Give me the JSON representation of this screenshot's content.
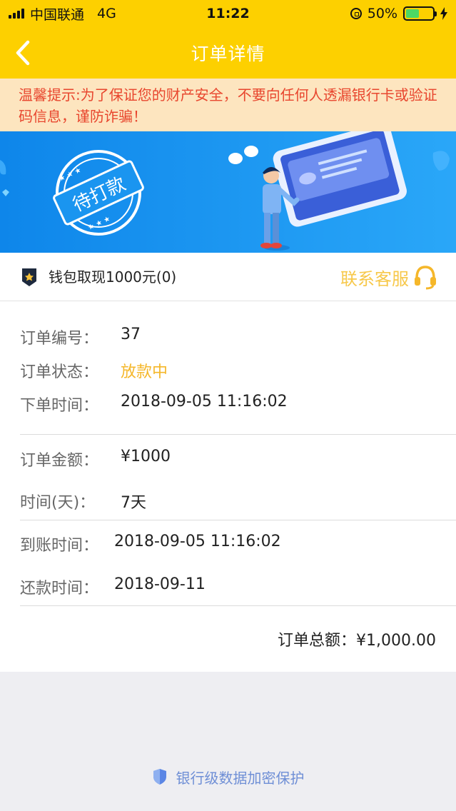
{
  "status_bar": {
    "carrier": "中国联通",
    "network": "4G",
    "time": "11:22",
    "battery": "50%",
    "battery_level": 0.5
  },
  "nav": {
    "title": "订单详情"
  },
  "warning": {
    "text": "温馨提示:为了保证您的财产安全，不要向任何人透漏银行卡或验证码信息，谨防诈骗！"
  },
  "banner": {
    "stamp": "待打款"
  },
  "wallet": {
    "text": "钱包取现1000元(0)",
    "contact": "联系客服"
  },
  "details": {
    "order_no_label": "订单编号：",
    "order_no": "37",
    "status_label": "订单状态：",
    "status": "放款中",
    "order_time_label": "下单时间：",
    "order_time": "2018-09-05 11:16:02",
    "amount_label": "订单金额：",
    "amount": "¥1000",
    "days_label": "时间(天)：",
    "days": "7天",
    "arrival_label": "到账时间：",
    "arrival": "2018-09-05 11:16:02",
    "repay_label": "还款时间：",
    "repay": "2018-09-11",
    "total_label": "订单总额：",
    "total": "¥1,000.00"
  },
  "footer": {
    "text": "银行级数据加密保护"
  },
  "colors": {
    "brand_yellow": "#fdd000",
    "warning_bg": "#fde5bf",
    "warning_text": "#e8462e",
    "banner_blue": "#1a95f0",
    "status_yellow": "#f5b72a",
    "footer_blue": "#6f8fd6"
  }
}
